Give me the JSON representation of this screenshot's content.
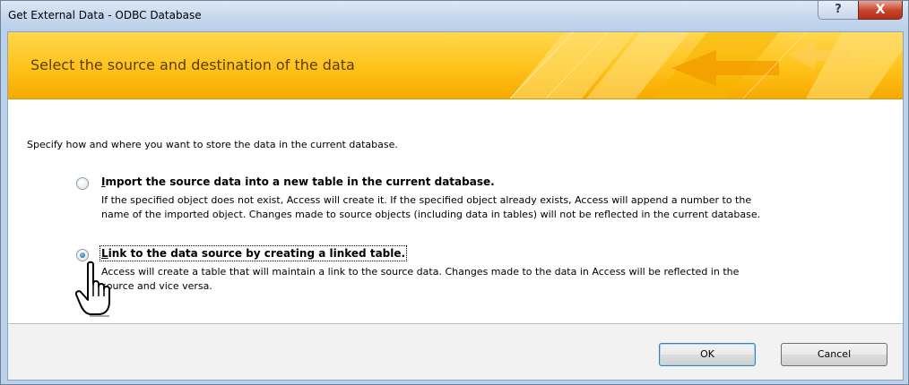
{
  "window": {
    "title": "Get External Data - ODBC Database",
    "help_glyph": "?",
    "close_glyph": "X"
  },
  "banner": {
    "heading": "Select the source and destination of the data"
  },
  "instruction": "Specify how and where you want to store the data in the current database.",
  "options": [
    {
      "accel": "I",
      "title_rest": "mport the source data into a new table in the current database.",
      "selected": false,
      "desc_line1": "If the specified object does not exist, Access will create it. If the specified object already exists, Access will append a number to the",
      "desc_line2": "name of the imported object. Changes made to source objects (including data in tables) will not be reflected in the current database."
    },
    {
      "accel": "L",
      "title_rest": "ink to the data source by creating a linked table.",
      "selected": true,
      "desc_line1": "Access will create a table that will maintain a link to the source data. Changes made to the data in Access will be reflected in the",
      "desc_line2": "source and vice versa."
    }
  ],
  "buttons": {
    "ok": "OK",
    "cancel": "Cancel"
  },
  "cursor_icon": "hand-pointer-icon",
  "colors": {
    "banner": "#ffc21a",
    "banner_text": "#5a3e00",
    "title_bg": "#c7d9ee",
    "close": "#c7432a"
  }
}
